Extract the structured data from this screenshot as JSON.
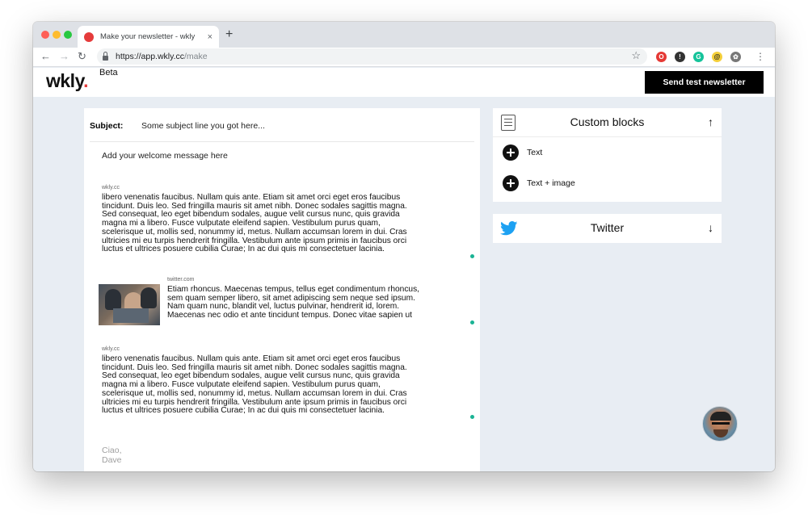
{
  "browser": {
    "tab_title": "Make your newsletter - wkly",
    "tab_close": "×",
    "new_tab": "+",
    "url_host": "https://app.wkly.cc",
    "url_path": "/make",
    "back": "←",
    "forward": "→",
    "reload": "↻",
    "star": "☆",
    "menu": "⋮",
    "extensions": [
      {
        "name": "opera-icon",
        "glyph": "O",
        "color": "#e53935"
      },
      {
        "name": "info-icon",
        "glyph": "!",
        "color": "#333333"
      },
      {
        "name": "grammarly-icon",
        "glyph": "G",
        "color": "#15c39a"
      },
      {
        "name": "at-mention-icon",
        "glyph": "@",
        "color": "#f5d03b"
      },
      {
        "name": "incognito-icon",
        "glyph": "✿",
        "color": "#777777"
      }
    ]
  },
  "header": {
    "logo": "wkly",
    "logo_dot": ".",
    "beta": "Beta",
    "send_button": "Send test newsletter"
  },
  "editor": {
    "subject_label": "Subject:",
    "subject_value": "Some subject line you got here...",
    "welcome": "Add your welcome message here",
    "blocks": [
      {
        "source": "wkly.cc",
        "lines": [
          "libero venenatis faucibus. Nullam quis ante. Etiam sit amet orci eget eros faucibus",
          "tincidunt. Duis leo. Sed fringilla mauris sit amet nibh. Donec sodales sagittis magna.",
          "Sed consequat, leo eget bibendum sodales, augue velit cursus nunc, quis gravida",
          "magna mi a libero. Fusce vulputate eleifend sapien. Vestibulum purus quam,",
          "scelerisque ut, mollis sed, nonummy id, metus. Nullam accumsan lorem in dui. Cras",
          "ultricies mi eu turpis hendrerit fringilla. Vestibulum ante ipsum primis in faucibus orci",
          "luctus et ultrices posuere cubilia Curae; In ac dui quis mi consectetuer lacinia."
        ]
      },
      {
        "source": "twitter.com",
        "lines": [
          "Etiam rhoncus. Maecenas tempus, tellus eget condimentum rhoncus,",
          "sem quam semper libero, sit amet adipiscing sem neque sed ipsum.",
          "Nam quam nunc, blandit vel, luctus pulvinar, hendrerit id, lorem.",
          "Maecenas nec odio et ante tincidunt tempus. Donec vitae sapien ut"
        ]
      },
      {
        "source": "wkly.cc",
        "lines": [
          "libero venenatis faucibus. Nullam quis ante. Etiam sit amet orci eget eros faucibus",
          "tincidunt. Duis leo. Sed fringilla mauris sit amet nibh. Donec sodales sagittis magna.",
          "Sed consequat, leo eget bibendum sodales, augue velit cursus nunc, quis gravida",
          "magna mi a libero. Fusce vulputate eleifend sapien. Vestibulum purus quam,",
          "scelerisque ut, mollis sed, nonummy id, metus. Nullam accumsan lorem in dui. Cras",
          "ultricies mi eu turpis hendrerit fringilla. Vestibulum ante ipsum primis in faucibus orci",
          "luctus et ultrices posuere cubilia Curae; In ac dui quis mi consectetuer lacinia."
        ]
      }
    ],
    "signoff_line1": "Ciao,",
    "signoff_line2": "Dave"
  },
  "sidebar": {
    "custom_blocks": {
      "title": "Custom blocks",
      "arrow": "↑",
      "items": [
        "Text",
        "Text + image"
      ]
    },
    "twitter": {
      "title": "Twitter",
      "arrow": "↓"
    }
  },
  "colors": {
    "accent": "#1ab394",
    "logo_dot": "#e53b3b",
    "twitter": "#1da1f2",
    "background": "#e8edf3"
  }
}
